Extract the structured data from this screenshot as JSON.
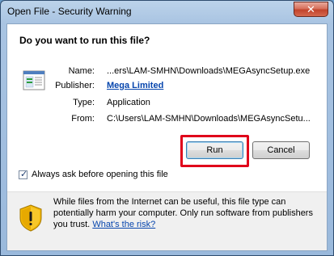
{
  "window": {
    "title": "Open File - Security Warning",
    "close_symbol": "✕"
  },
  "dialog": {
    "question": "Do you want to run this file?",
    "fields": {
      "name_label": "Name:",
      "name_value": "...ers\\LAM-SMHN\\Downloads\\MEGAsyncSetup.exe",
      "publisher_label": "Publisher:",
      "publisher_value": "Mega Limited",
      "type_label": "Type:",
      "type_value": "Application",
      "from_label": "From:",
      "from_value": "C:\\Users\\LAM-SMHN\\Downloads\\MEGAsyncSetu..."
    },
    "buttons": {
      "run_label": "Run",
      "cancel_label": "Cancel"
    },
    "checkbox": {
      "label": "Always ask before opening this file",
      "checked": true
    },
    "warning": {
      "text": "While files from the Internet can be useful, this file type can potentially harm your computer. Only run software from publishers you trust.",
      "link": "What's the risk?"
    },
    "icons": {
      "file": "application-file-icon",
      "warning": "security-shield-icon"
    },
    "colors": {
      "highlight": "#e0001a",
      "link": "#0645ad"
    }
  }
}
